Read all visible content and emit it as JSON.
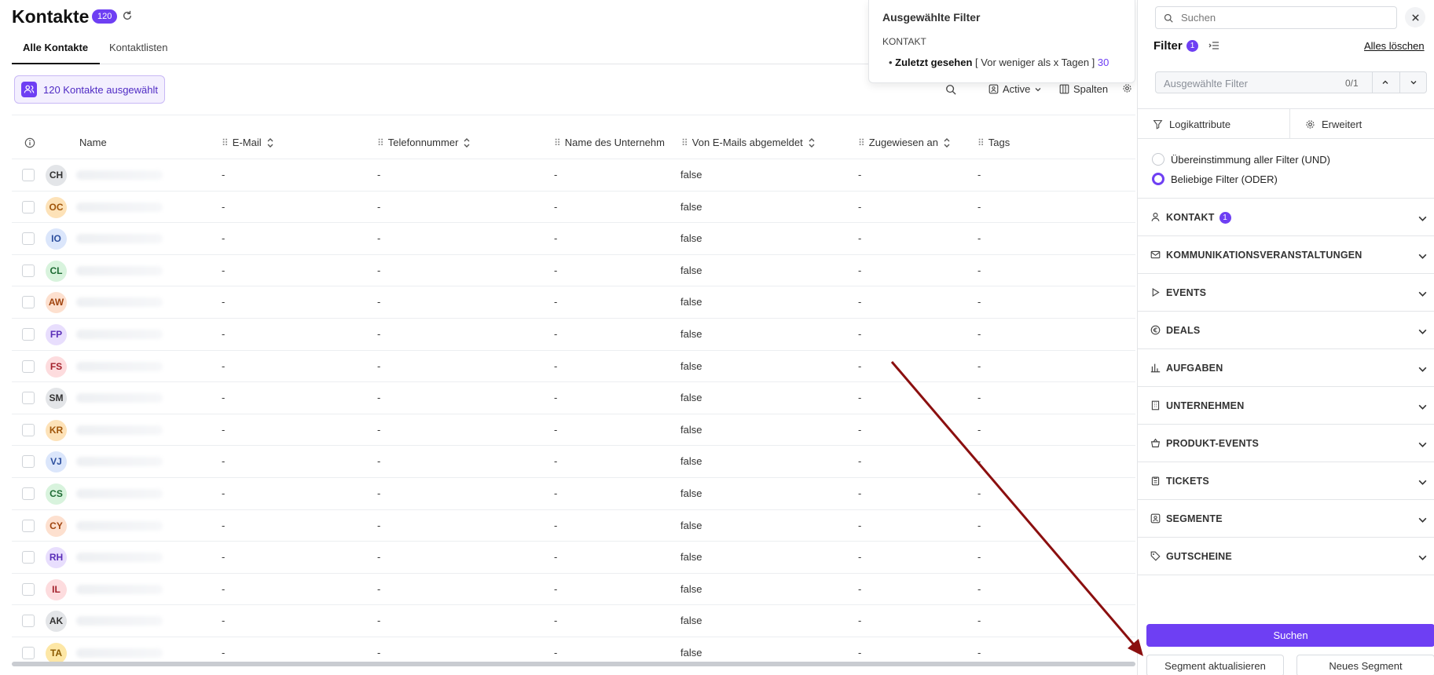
{
  "header": {
    "title": "Kontakte",
    "count_badge": "120"
  },
  "tabs": [
    {
      "label": "Alle Kontakte",
      "active": true
    },
    {
      "label": "Kontaktlisten",
      "active": false
    }
  ],
  "selection_chip": {
    "label": "120 Kontakte ausgewählt"
  },
  "toolbar": {
    "active_label": "Active",
    "columns_label": "Spalten"
  },
  "table": {
    "columns": [
      "Name",
      "E-Mail",
      "Telefonnummer",
      "Name des Unternehm",
      "Von E-Mails abgemeldet",
      "Zugewiesen an",
      "Tags"
    ],
    "rows": [
      {
        "initials": "CH",
        "email": "-",
        "phone": "-",
        "company": "-",
        "unsubscribed": "false",
        "assigned": "-",
        "tags": "-"
      },
      {
        "initials": "OC",
        "email": "-",
        "phone": "-",
        "company": "-",
        "unsubscribed": "false",
        "assigned": "-",
        "tags": "-"
      },
      {
        "initials": "IO",
        "email": "-",
        "phone": "-",
        "company": "-",
        "unsubscribed": "false",
        "assigned": "-",
        "tags": "-"
      },
      {
        "initials": "CL",
        "email": "-",
        "phone": "-",
        "company": "-",
        "unsubscribed": "false",
        "assigned": "-",
        "tags": "-"
      },
      {
        "initials": "AW",
        "email": "-",
        "phone": "-",
        "company": "-",
        "unsubscribed": "false",
        "assigned": "-",
        "tags": "-"
      },
      {
        "initials": "FP",
        "email": "-",
        "phone": "-",
        "company": "-",
        "unsubscribed": "false",
        "assigned": "-",
        "tags": "-"
      },
      {
        "initials": "FS",
        "email": "-",
        "phone": "-",
        "company": "-",
        "unsubscribed": "false",
        "assigned": "-",
        "tags": "-"
      },
      {
        "initials": "SM",
        "email": "-",
        "phone": "-",
        "company": "-",
        "unsubscribed": "false",
        "assigned": "-",
        "tags": "-"
      },
      {
        "initials": "KR",
        "email": "-",
        "phone": "-",
        "company": "-",
        "unsubscribed": "false",
        "assigned": "-",
        "tags": "-"
      },
      {
        "initials": "VJ",
        "email": "-",
        "phone": "-",
        "company": "-",
        "unsubscribed": "false",
        "assigned": "-",
        "tags": "-"
      },
      {
        "initials": "CS",
        "email": "-",
        "phone": "-",
        "company": "-",
        "unsubscribed": "false",
        "assigned": "-",
        "tags": "-"
      },
      {
        "initials": "CY",
        "email": "-",
        "phone": "-",
        "company": "-",
        "unsubscribed": "false",
        "assigned": "-",
        "tags": "-"
      },
      {
        "initials": "RH",
        "email": "-",
        "phone": "-",
        "company": "-",
        "unsubscribed": "false",
        "assigned": "-",
        "tags": "-"
      },
      {
        "initials": "IL",
        "email": "-",
        "phone": "-",
        "company": "-",
        "unsubscribed": "false",
        "assigned": "-",
        "tags": "-"
      },
      {
        "initials": "AK",
        "email": "-",
        "phone": "-",
        "company": "-",
        "unsubscribed": "false",
        "assigned": "-",
        "tags": "-"
      },
      {
        "initials": "TA",
        "email": "-",
        "phone": "-",
        "company": "-",
        "unsubscribed": "false",
        "assigned": "-",
        "tags": "-"
      }
    ]
  },
  "filter_popup": {
    "title": "Ausgewählte Filter",
    "section": "KONTAKT",
    "item_name": "Zuletzt gesehen",
    "item_condition": "[ Vor weniger als x Tagen ]",
    "item_value": "30"
  },
  "filter_panel": {
    "search_placeholder": "Suchen",
    "filter_label": "Filter",
    "filter_count": "1",
    "clear_all": "Alles löschen",
    "selected_placeholder": "Ausgewählte Filter",
    "selected_count": "0/1",
    "tabs": [
      "Logikattribute",
      "Erweitert"
    ],
    "logic_options": [
      {
        "label": "Übereinstimmung aller Filter (UND)",
        "selected": false
      },
      {
        "label": "Beliebige Filter (ODER)",
        "selected": true
      }
    ],
    "categories": [
      {
        "label": "KONTAKT",
        "icon": "person-icon",
        "badge": "1"
      },
      {
        "label": "KOMMUNIKATIONSVERANSTALTUNGEN",
        "icon": "mail-icon",
        "badge": ""
      },
      {
        "label": "EVENTS",
        "icon": "play-icon",
        "badge": ""
      },
      {
        "label": "DEALS",
        "icon": "euro-icon",
        "badge": ""
      },
      {
        "label": "AUFGABEN",
        "icon": "bar-chart-icon",
        "badge": ""
      },
      {
        "label": "UNTERNEHMEN",
        "icon": "building-icon",
        "badge": ""
      },
      {
        "label": "PRODUKT-EVENTS",
        "icon": "basket-icon",
        "badge": ""
      },
      {
        "label": "TICKETS",
        "icon": "clipboard-icon",
        "badge": ""
      },
      {
        "label": "SEGMENTE",
        "icon": "segment-icon",
        "badge": ""
      },
      {
        "label": "GUTSCHEINE",
        "icon": "tag-icon",
        "badge": ""
      }
    ],
    "search_button": "Suchen",
    "update_segment_button": "Segment aktualisieren",
    "new_segment_button": "Neues Segment"
  },
  "colors": {
    "accent": "#6e3ff3",
    "annotation_arrow": "#8b0f0f"
  }
}
